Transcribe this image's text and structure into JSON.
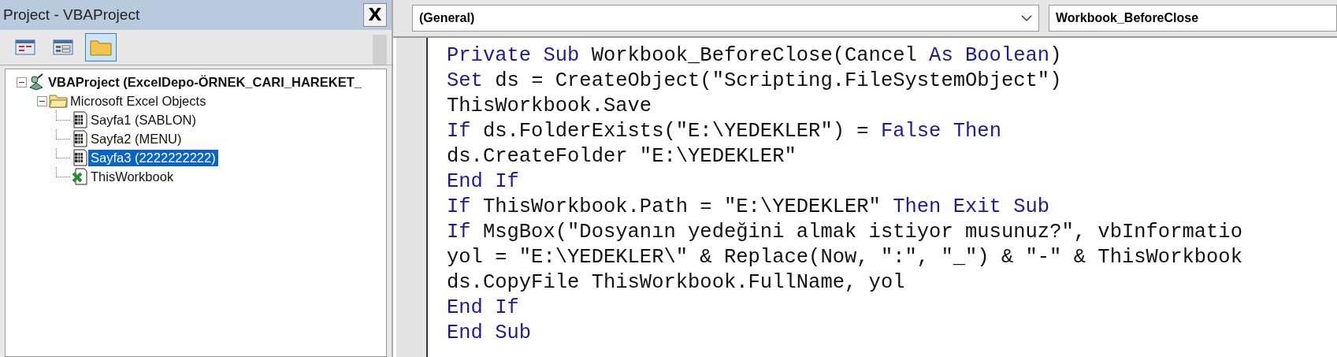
{
  "project_panel": {
    "title": "Project - VBAProject",
    "close": "X",
    "toolbar": [
      {
        "kind": "view-code",
        "selected": false
      },
      {
        "kind": "view-object",
        "selected": false
      },
      {
        "kind": "toggle-folders",
        "selected": true
      }
    ],
    "tree": [
      {
        "kind": "project",
        "label": "VBAProject (ExcelDepo-ÖRNEK_CARI_HAREKET_",
        "expanded": true,
        "selected": false,
        "children": [
          {
            "kind": "folder",
            "label": "Microsoft Excel Objects",
            "expanded": true,
            "selected": false,
            "children": [
              {
                "kind": "sheet",
                "label": "Sayfa1 (SABLON)",
                "selected": false
              },
              {
                "kind": "sheet",
                "label": "Sayfa2 (MENU)",
                "selected": false
              },
              {
                "kind": "sheet",
                "label": "Sayfa3 (2222222222)",
                "selected": true
              },
              {
                "kind": "workbook",
                "label": "ThisWorkbook",
                "selected": false
              }
            ]
          }
        ]
      }
    ]
  },
  "code_window": {
    "object_combo": "(General)",
    "procedure_combo": "Workbook_BeforeClose",
    "lines": [
      [
        {
          "kind": "keyword",
          "text": "Private Sub"
        },
        {
          "kind": "plain",
          "text": " Workbook_BeforeClose(Cancel "
        },
        {
          "kind": "keyword",
          "text": "As Boolean"
        },
        {
          "kind": "plain",
          "text": ")"
        }
      ],
      [
        {
          "kind": "keyword",
          "text": "Set"
        },
        {
          "kind": "plain",
          "text": " ds = CreateObject(\"Scripting.FileSystemObject\")"
        }
      ],
      [
        {
          "kind": "plain",
          "text": "ThisWorkbook.Save"
        }
      ],
      [
        {
          "kind": "keyword",
          "text": "If"
        },
        {
          "kind": "plain",
          "text": " ds.FolderExists(\"E:\\YEDEKLER\") = "
        },
        {
          "kind": "keyword",
          "text": "False Then"
        }
      ],
      [
        {
          "kind": "plain",
          "text": "ds.CreateFolder \"E:\\YEDEKLER\""
        }
      ],
      [
        {
          "kind": "keyword",
          "text": "End If"
        }
      ],
      [
        {
          "kind": "keyword",
          "text": "If"
        },
        {
          "kind": "plain",
          "text": " ThisWorkbook.Path = \"E:\\YEDEKLER\" "
        },
        {
          "kind": "keyword",
          "text": "Then Exit Sub"
        }
      ],
      [
        {
          "kind": "keyword",
          "text": "If"
        },
        {
          "kind": "plain",
          "text": " MsgBox(\"Dosyanın yedeğini almak istiyor musunuz?\", vbInformatio"
        }
      ],
      [
        {
          "kind": "plain",
          "text": "yol = \"E:\\YEDEKLER\\\" & Replace(Now, \":\", \"_\") & \"-\" & ThisWorkbook"
        }
      ],
      [
        {
          "kind": "plain",
          "text": "ds.CopyFile ThisWorkbook.FullName, yol"
        }
      ],
      [
        {
          "kind": "keyword",
          "text": "End If"
        }
      ],
      [
        {
          "kind": "keyword",
          "text": "End Sub"
        }
      ]
    ]
  }
}
